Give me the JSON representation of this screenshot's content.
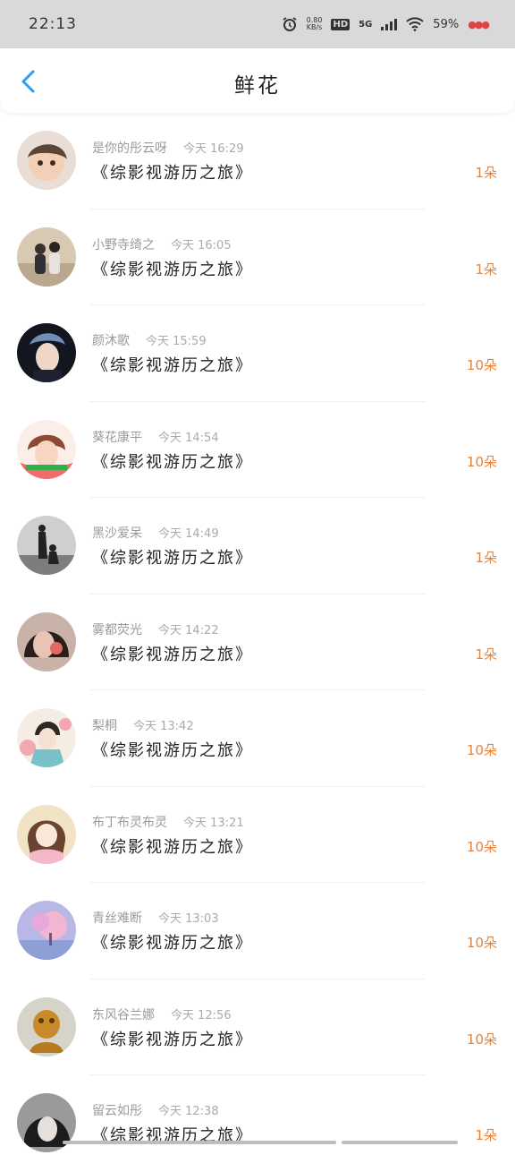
{
  "status_bar": {
    "time": "22:13",
    "net_speed_value": "0.80",
    "net_speed_unit": "KB/s",
    "hd_label": "HD",
    "network_label": "5G",
    "battery": "59%",
    "colors": {
      "background": "#d9d9d9",
      "text": "#333333"
    }
  },
  "header": {
    "title": "鲜花",
    "back_icon": "chevron-left-icon",
    "back_color": "#2a9df4"
  },
  "list": {
    "count_color": "#e8833a",
    "items": [
      {
        "name": "是你的彤云呀",
        "time": "今天 16:29",
        "book": "《综影视游历之旅》",
        "count": "1朵"
      },
      {
        "name": "小野寺绮之",
        "time": "今天 16:05",
        "book": "《综影视游历之旅》",
        "count": "1朵"
      },
      {
        "name": "颜沐歌",
        "time": "今天 15:59",
        "book": "《综影视游历之旅》",
        "count": "10朵"
      },
      {
        "name": "葵花康平",
        "time": "今天 14:54",
        "book": "《综影视游历之旅》",
        "count": "10朵"
      },
      {
        "name": "黑沙爱呆",
        "time": "今天 14:49",
        "book": "《综影视游历之旅》",
        "count": "1朵"
      },
      {
        "name": "雾都荧光",
        "time": "今天 14:22",
        "book": "《综影视游历之旅》",
        "count": "1朵"
      },
      {
        "name": "梨桐",
        "time": "今天 13:42",
        "book": "《综影视游历之旅》",
        "count": "10朵"
      },
      {
        "name": "布丁布灵布灵",
        "time": "今天 13:21",
        "book": "《综影视游历之旅》",
        "count": "10朵"
      },
      {
        "name": "青丝难断",
        "time": "今天 13:03",
        "book": "《综影视游历之旅》",
        "count": "10朵"
      },
      {
        "name": "东风谷兰娜",
        "time": "今天 12:56",
        "book": "《综影视游历之旅》",
        "count": "10朵"
      },
      {
        "name": "留云如彤",
        "time": "今天 12:38",
        "book": "《综影视游历之旅》",
        "count": "1朵"
      }
    ]
  }
}
